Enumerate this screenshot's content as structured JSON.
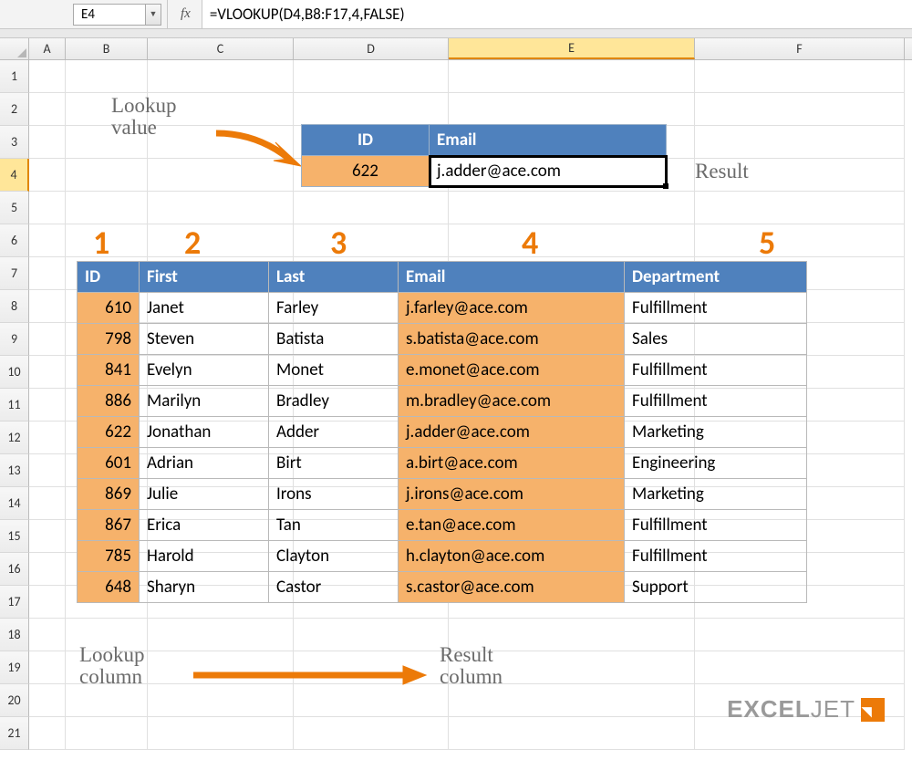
{
  "name_box": "E4",
  "formula": "=VLOOKUP(D4,B8:F17,4,FALSE)",
  "columns": [
    "A",
    "B",
    "C",
    "D",
    "E",
    "F"
  ],
  "active_column": "E",
  "active_row": 4,
  "row_count": 21,
  "annotations": {
    "lookup_value": "Lookup\nvalue",
    "result": "Result",
    "lookup_column": "Lookup\ncolumn",
    "result_column": "Result\ncolumn"
  },
  "col_numbers": [
    "1",
    "2",
    "3",
    "4",
    "5"
  ],
  "mini_table": {
    "headers": [
      "ID",
      "Email"
    ],
    "id": "622",
    "email": "j.adder@ace.com"
  },
  "data_table": {
    "headers": [
      "ID",
      "First",
      "Last",
      "Email",
      "Department"
    ],
    "rows": [
      {
        "id": "610",
        "first": "Janet",
        "last": "Farley",
        "email": "j.farley@ace.com",
        "dept": "Fulfillment"
      },
      {
        "id": "798",
        "first": "Steven",
        "last": "Batista",
        "email": "s.batista@ace.com",
        "dept": "Sales"
      },
      {
        "id": "841",
        "first": "Evelyn",
        "last": "Monet",
        "email": "e.monet@ace.com",
        "dept": "Fulfillment"
      },
      {
        "id": "886",
        "first": "Marilyn",
        "last": "Bradley",
        "email": "m.bradley@ace.com",
        "dept": "Fulfillment"
      },
      {
        "id": "622",
        "first": "Jonathan",
        "last": "Adder",
        "email": "j.adder@ace.com",
        "dept": "Marketing"
      },
      {
        "id": "601",
        "first": "Adrian",
        "last": "Birt",
        "email": "a.birt@ace.com",
        "dept": "Engineering"
      },
      {
        "id": "869",
        "first": "Julie",
        "last": "Irons",
        "email": "j.irons@ace.com",
        "dept": "Marketing"
      },
      {
        "id": "867",
        "first": "Erica",
        "last": "Tan",
        "email": "e.tan@ace.com",
        "dept": "Fulfillment"
      },
      {
        "id": "785",
        "first": "Harold",
        "last": "Clayton",
        "email": "h.clayton@ace.com",
        "dept": "Fulfillment"
      },
      {
        "id": "648",
        "first": "Sharyn",
        "last": "Castor",
        "email": "s.castor@ace.com",
        "dept": "Support"
      }
    ]
  },
  "logo": {
    "part1": "EXCEL",
    "part2": "JET"
  }
}
